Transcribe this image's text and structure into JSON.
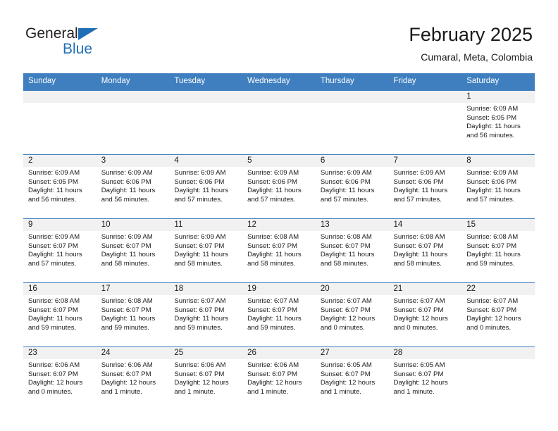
{
  "logo": {
    "word1": "General",
    "word2": "Blue",
    "accent_color": "#1f6fb4",
    "triangle_icon": "triangle-icon"
  },
  "header": {
    "title": "February 2025",
    "subtitle": "Cumaral, Meta, Colombia"
  },
  "calendar": {
    "header_bg": "#3f7fbf",
    "daynum_bg": "#f1f1f1",
    "weekdays": [
      "Sunday",
      "Monday",
      "Tuesday",
      "Wednesday",
      "Thursday",
      "Friday",
      "Saturday"
    ],
    "weeks": [
      [
        {
          "day": "",
          "empty": true
        },
        {
          "day": "",
          "empty": true
        },
        {
          "day": "",
          "empty": true
        },
        {
          "day": "",
          "empty": true
        },
        {
          "day": "",
          "empty": true
        },
        {
          "day": "",
          "empty": true
        },
        {
          "day": "1",
          "sunrise": "Sunrise: 6:09 AM",
          "sunset": "Sunset: 6:05 PM",
          "daylight1": "Daylight: 11 hours",
          "daylight2": "and 56 minutes."
        }
      ],
      [
        {
          "day": "2",
          "sunrise": "Sunrise: 6:09 AM",
          "sunset": "Sunset: 6:05 PM",
          "daylight1": "Daylight: 11 hours",
          "daylight2": "and 56 minutes."
        },
        {
          "day": "3",
          "sunrise": "Sunrise: 6:09 AM",
          "sunset": "Sunset: 6:06 PM",
          "daylight1": "Daylight: 11 hours",
          "daylight2": "and 56 minutes."
        },
        {
          "day": "4",
          "sunrise": "Sunrise: 6:09 AM",
          "sunset": "Sunset: 6:06 PM",
          "daylight1": "Daylight: 11 hours",
          "daylight2": "and 57 minutes."
        },
        {
          "day": "5",
          "sunrise": "Sunrise: 6:09 AM",
          "sunset": "Sunset: 6:06 PM",
          "daylight1": "Daylight: 11 hours",
          "daylight2": "and 57 minutes."
        },
        {
          "day": "6",
          "sunrise": "Sunrise: 6:09 AM",
          "sunset": "Sunset: 6:06 PM",
          "daylight1": "Daylight: 11 hours",
          "daylight2": "and 57 minutes."
        },
        {
          "day": "7",
          "sunrise": "Sunrise: 6:09 AM",
          "sunset": "Sunset: 6:06 PM",
          "daylight1": "Daylight: 11 hours",
          "daylight2": "and 57 minutes."
        },
        {
          "day": "8",
          "sunrise": "Sunrise: 6:09 AM",
          "sunset": "Sunset: 6:06 PM",
          "daylight1": "Daylight: 11 hours",
          "daylight2": "and 57 minutes."
        }
      ],
      [
        {
          "day": "9",
          "sunrise": "Sunrise: 6:09 AM",
          "sunset": "Sunset: 6:07 PM",
          "daylight1": "Daylight: 11 hours",
          "daylight2": "and 57 minutes."
        },
        {
          "day": "10",
          "sunrise": "Sunrise: 6:09 AM",
          "sunset": "Sunset: 6:07 PM",
          "daylight1": "Daylight: 11 hours",
          "daylight2": "and 58 minutes."
        },
        {
          "day": "11",
          "sunrise": "Sunrise: 6:09 AM",
          "sunset": "Sunset: 6:07 PM",
          "daylight1": "Daylight: 11 hours",
          "daylight2": "and 58 minutes."
        },
        {
          "day": "12",
          "sunrise": "Sunrise: 6:08 AM",
          "sunset": "Sunset: 6:07 PM",
          "daylight1": "Daylight: 11 hours",
          "daylight2": "and 58 minutes."
        },
        {
          "day": "13",
          "sunrise": "Sunrise: 6:08 AM",
          "sunset": "Sunset: 6:07 PM",
          "daylight1": "Daylight: 11 hours",
          "daylight2": "and 58 minutes."
        },
        {
          "day": "14",
          "sunrise": "Sunrise: 6:08 AM",
          "sunset": "Sunset: 6:07 PM",
          "daylight1": "Daylight: 11 hours",
          "daylight2": "and 58 minutes."
        },
        {
          "day": "15",
          "sunrise": "Sunrise: 6:08 AM",
          "sunset": "Sunset: 6:07 PM",
          "daylight1": "Daylight: 11 hours",
          "daylight2": "and 59 minutes."
        }
      ],
      [
        {
          "day": "16",
          "sunrise": "Sunrise: 6:08 AM",
          "sunset": "Sunset: 6:07 PM",
          "daylight1": "Daylight: 11 hours",
          "daylight2": "and 59 minutes."
        },
        {
          "day": "17",
          "sunrise": "Sunrise: 6:08 AM",
          "sunset": "Sunset: 6:07 PM",
          "daylight1": "Daylight: 11 hours",
          "daylight2": "and 59 minutes."
        },
        {
          "day": "18",
          "sunrise": "Sunrise: 6:07 AM",
          "sunset": "Sunset: 6:07 PM",
          "daylight1": "Daylight: 11 hours",
          "daylight2": "and 59 minutes."
        },
        {
          "day": "19",
          "sunrise": "Sunrise: 6:07 AM",
          "sunset": "Sunset: 6:07 PM",
          "daylight1": "Daylight: 11 hours",
          "daylight2": "and 59 minutes."
        },
        {
          "day": "20",
          "sunrise": "Sunrise: 6:07 AM",
          "sunset": "Sunset: 6:07 PM",
          "daylight1": "Daylight: 12 hours",
          "daylight2": "and 0 minutes."
        },
        {
          "day": "21",
          "sunrise": "Sunrise: 6:07 AM",
          "sunset": "Sunset: 6:07 PM",
          "daylight1": "Daylight: 12 hours",
          "daylight2": "and 0 minutes."
        },
        {
          "day": "22",
          "sunrise": "Sunrise: 6:07 AM",
          "sunset": "Sunset: 6:07 PM",
          "daylight1": "Daylight: 12 hours",
          "daylight2": "and 0 minutes."
        }
      ],
      [
        {
          "day": "23",
          "sunrise": "Sunrise: 6:06 AM",
          "sunset": "Sunset: 6:07 PM",
          "daylight1": "Daylight: 12 hours",
          "daylight2": "and 0 minutes."
        },
        {
          "day": "24",
          "sunrise": "Sunrise: 6:06 AM",
          "sunset": "Sunset: 6:07 PM",
          "daylight1": "Daylight: 12 hours",
          "daylight2": "and 1 minute."
        },
        {
          "day": "25",
          "sunrise": "Sunrise: 6:06 AM",
          "sunset": "Sunset: 6:07 PM",
          "daylight1": "Daylight: 12 hours",
          "daylight2": "and 1 minute."
        },
        {
          "day": "26",
          "sunrise": "Sunrise: 6:06 AM",
          "sunset": "Sunset: 6:07 PM",
          "daylight1": "Daylight: 12 hours",
          "daylight2": "and 1 minute."
        },
        {
          "day": "27",
          "sunrise": "Sunrise: 6:05 AM",
          "sunset": "Sunset: 6:07 PM",
          "daylight1": "Daylight: 12 hours",
          "daylight2": "and 1 minute."
        },
        {
          "day": "28",
          "sunrise": "Sunrise: 6:05 AM",
          "sunset": "Sunset: 6:07 PM",
          "daylight1": "Daylight: 12 hours",
          "daylight2": "and 1 minute."
        },
        {
          "day": "",
          "empty": true
        }
      ]
    ]
  }
}
